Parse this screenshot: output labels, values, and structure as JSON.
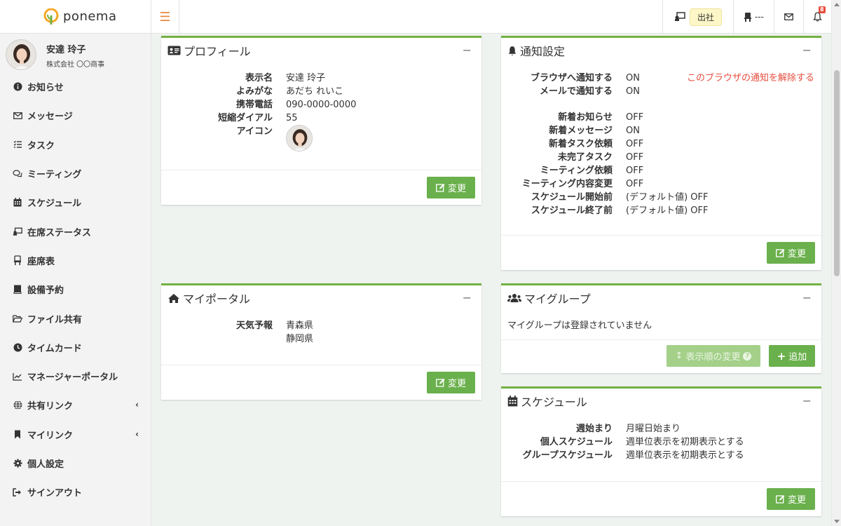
{
  "app": {
    "name": "ponema"
  },
  "topbar": {
    "status": "出社",
    "seat": "---",
    "notification_count": "8"
  },
  "user": {
    "name": "安達 玲子",
    "company": "株式会社 〇〇商事"
  },
  "nav": [
    {
      "label": "お知らせ",
      "icon": "info-icon"
    },
    {
      "label": "メッセージ",
      "icon": "envelope-icon"
    },
    {
      "label": "タスク",
      "icon": "tasks-icon"
    },
    {
      "label": "ミーティング",
      "icon": "chat-icon"
    },
    {
      "label": "スケジュール",
      "icon": "calendar-icon"
    },
    {
      "label": "在席ステータス",
      "icon": "presence-icon"
    },
    {
      "label": "座席表",
      "icon": "seat-icon"
    },
    {
      "label": "設備予約",
      "icon": "book-icon"
    },
    {
      "label": "ファイル共有",
      "icon": "folder-icon"
    },
    {
      "label": "タイムカード",
      "icon": "clock-icon"
    },
    {
      "label": "マネージャーポータル",
      "icon": "chart-icon"
    },
    {
      "label": "共有リンク",
      "icon": "globe-icon"
    },
    {
      "label": "マイリンク",
      "icon": "bookmark-icon"
    },
    {
      "label": "個人設定",
      "icon": "gear-icon"
    },
    {
      "label": "サインアウト",
      "icon": "signout-icon"
    }
  ],
  "profile": {
    "title": "プロフィール",
    "rows": [
      {
        "k": "表示名",
        "v": "安達 玲子"
      },
      {
        "k": "よみがな",
        "v": "あだち れいこ"
      },
      {
        "k": "携帯電話",
        "v": "090-0000-0000"
      },
      {
        "k": "短縮ダイアル",
        "v": "55"
      },
      {
        "k": "アイコン",
        "v": ""
      }
    ],
    "button": "変更"
  },
  "notify": {
    "title": "通知設定",
    "rows": [
      {
        "k": "ブラウザへ通知する",
        "v": "ON"
      },
      {
        "k": "メールで通知する",
        "v": "ON"
      }
    ],
    "rows2": [
      {
        "k": "新着お知らせ",
        "v": "OFF"
      },
      {
        "k": "新着メッセージ",
        "v": "ON"
      },
      {
        "k": "新着タスク依頼",
        "v": "OFF"
      },
      {
        "k": "未完了タスク",
        "v": "OFF"
      },
      {
        "k": "ミーティング依頼",
        "v": "OFF"
      },
      {
        "k": "ミーティング内容変更",
        "v": "OFF"
      },
      {
        "k": "スケジュール開始前",
        "v": "(デフォルト値) OFF"
      },
      {
        "k": "スケジュール終了前",
        "v": "(デフォルト値) OFF"
      }
    ],
    "unsubscribe": "このブラウザの通知を解除する",
    "button": "変更"
  },
  "portal": {
    "title": "マイポータル",
    "weather_label": "天気予報",
    "weather": [
      "青森県",
      "静岡県"
    ],
    "button": "変更"
  },
  "group": {
    "title": "マイグループ",
    "empty": "マイグループは登録されていません",
    "order_button": "表示順の変更",
    "add_button": "追加"
  },
  "schedule": {
    "title": "スケジュール",
    "rows": [
      {
        "k": "週始まり",
        "v": "月曜日始まり"
      },
      {
        "k": "個人スケジュール",
        "v": "週単位表示を初期表示とする"
      },
      {
        "k": "グループスケジュール",
        "v": "週単位表示を初期表示とする"
      }
    ],
    "button": "変更"
  },
  "colors": {
    "accent": "#73b143",
    "button": "#6ab04c",
    "link": "#e74c3c",
    "menu": "#e8893a"
  }
}
